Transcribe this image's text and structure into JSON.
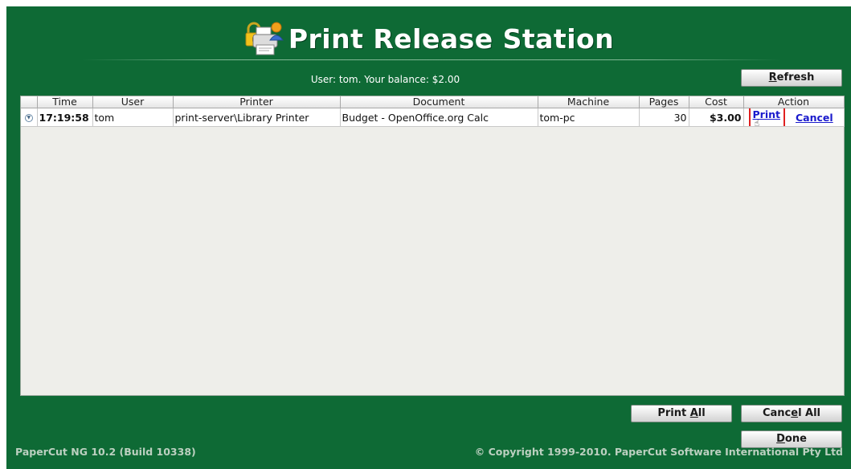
{
  "header": {
    "title": "Print Release Station"
  },
  "balance_text": "User: tom. Your balance: $2.00",
  "buttons": {
    "refresh": {
      "before": "",
      "mnemonic": "R",
      "after": "efresh"
    },
    "print_all": {
      "before": "Print ",
      "mnemonic": "A",
      "after": "ll"
    },
    "cancel_all": {
      "before": "Canc",
      "mnemonic": "e",
      "after": "l All"
    },
    "done": {
      "before": "",
      "mnemonic": "D",
      "after": "one"
    }
  },
  "table": {
    "columns": [
      "Time",
      "User",
      "Printer",
      "Document",
      "Machine",
      "Pages",
      "Cost",
      "Action"
    ],
    "rows": [
      {
        "time": "17:19:58",
        "user": "tom",
        "printer": "print-server\\Library Printer",
        "document": "Budget - OpenOffice.org Calc",
        "machine": "tom-pc",
        "pages": "30",
        "cost": "$3.00",
        "print_label": "Print",
        "cancel_label": "Cancel"
      }
    ]
  },
  "footer": {
    "version": "PaperCut NG 10.2 (Build 10338)",
    "copyright": "© Copyright 1999-2010. PaperCut Software International Pty Ltd"
  },
  "colors": {
    "background": "#0e6a35",
    "link": "#1a1acc",
    "highlight": "#e02020"
  },
  "icons": [
    "printer-lock-logo-icon",
    "expand-row-icon",
    "hand-cursor-icon"
  ]
}
